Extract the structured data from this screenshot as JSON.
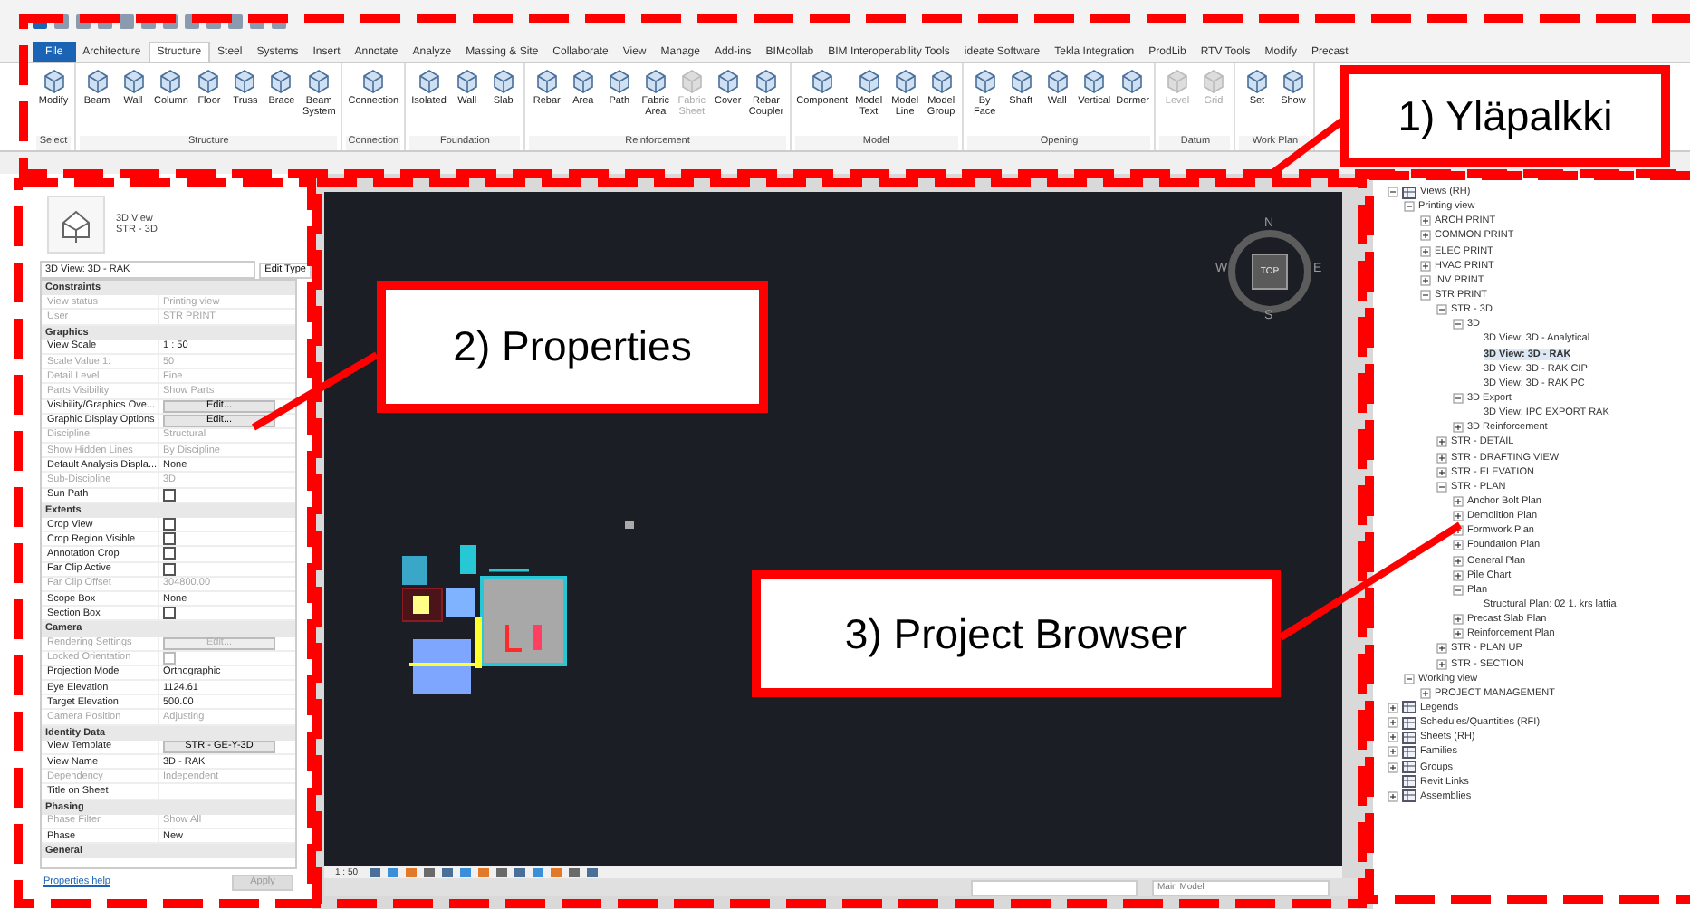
{
  "ribbon_tabs": [
    {
      "label": "File",
      "selected": false,
      "kind": "file"
    },
    {
      "label": "Architecture",
      "selected": false
    },
    {
      "label": "Structure",
      "selected": true
    },
    {
      "label": "Steel",
      "selected": false
    },
    {
      "label": "Systems",
      "selected": false
    },
    {
      "label": "Insert",
      "selected": false
    },
    {
      "label": "Annotate",
      "selected": false
    },
    {
      "label": "Analyze",
      "selected": false
    },
    {
      "label": "Massing & Site",
      "selected": false
    },
    {
      "label": "Collaborate",
      "selected": false
    },
    {
      "label": "View",
      "selected": false
    },
    {
      "label": "Manage",
      "selected": false
    },
    {
      "label": "Add-ins",
      "selected": false
    },
    {
      "label": "BIMcollab",
      "selected": false
    },
    {
      "label": "BIM Interoperability Tools",
      "selected": false
    },
    {
      "label": "ideate Software",
      "selected": false
    },
    {
      "label": "Tekla Integration",
      "selected": false
    },
    {
      "label": "ProdLib",
      "selected": false
    },
    {
      "label": "RTV Tools",
      "selected": false
    },
    {
      "label": "Modify",
      "selected": false
    },
    {
      "label": "Precast",
      "selected": false
    }
  ],
  "ribbon_panels": [
    {
      "label": "Select",
      "tools": [
        {
          "label": "Modify",
          "disabled": false
        }
      ]
    },
    {
      "label": "Structure",
      "tools": [
        {
          "label": "Beam",
          "disabled": false
        },
        {
          "label": "Wall",
          "disabled": false
        },
        {
          "label": "Column",
          "disabled": false
        },
        {
          "label": "Floor",
          "disabled": false
        },
        {
          "label": "Truss",
          "disabled": false
        },
        {
          "label": "Brace",
          "disabled": false
        },
        {
          "label": "Beam System",
          "disabled": false
        }
      ]
    },
    {
      "label": "Connection",
      "tools": [
        {
          "label": "Connection",
          "disabled": false
        }
      ]
    },
    {
      "label": "Foundation",
      "tools": [
        {
          "label": "Isolated",
          "disabled": false
        },
        {
          "label": "Wall",
          "disabled": false
        },
        {
          "label": "Slab",
          "disabled": false
        }
      ]
    },
    {
      "label": "Reinforcement",
      "tools": [
        {
          "label": "Rebar",
          "disabled": false
        },
        {
          "label": "Area",
          "disabled": false
        },
        {
          "label": "Path",
          "disabled": false
        },
        {
          "label": "Fabric Area",
          "disabled": false
        },
        {
          "label": "Fabric Sheet",
          "disabled": true
        },
        {
          "label": "Cover",
          "disabled": false
        },
        {
          "label": "Rebar Coupler",
          "disabled": false
        }
      ]
    },
    {
      "label": "Model",
      "tools": [
        {
          "label": "Component",
          "disabled": false
        },
        {
          "label": "Model Text",
          "disabled": false
        },
        {
          "label": "Model Line",
          "disabled": false
        },
        {
          "label": "Model Group",
          "disabled": false
        }
      ]
    },
    {
      "label": "Opening",
      "tools": [
        {
          "label": "By Face",
          "disabled": false
        },
        {
          "label": "Shaft",
          "disabled": false
        },
        {
          "label": "Wall",
          "disabled": false
        },
        {
          "label": "Vertical",
          "disabled": false
        },
        {
          "label": "Dormer",
          "disabled": false
        }
      ]
    },
    {
      "label": "Datum",
      "tools": [
        {
          "label": "Level",
          "disabled": true
        },
        {
          "label": "Grid",
          "disabled": true
        }
      ]
    },
    {
      "label": "Work Plan",
      "tools": [
        {
          "label": "Set",
          "disabled": false
        },
        {
          "label": "Show",
          "disabled": false
        }
      ]
    }
  ],
  "properties": {
    "family": "3D View",
    "type": "STR - 3D",
    "instance": "3D View: 3D - RAK",
    "edit_type": "Edit Type",
    "groups": [
      {
        "name": "Constraints",
        "rows": [
          {
            "label": "View status",
            "kind": "text",
            "value": "Printing view",
            "disabled": true
          },
          {
            "label": "User",
            "kind": "text",
            "value": "STR PRINT",
            "disabled": true
          }
        ]
      },
      {
        "name": "Graphics",
        "rows": [
          {
            "label": "View Scale",
            "kind": "text",
            "value": "1 : 50",
            "disabled": false
          },
          {
            "label": "Scale Value    1:",
            "kind": "text",
            "value": "50",
            "disabled": true
          },
          {
            "label": "Detail Level",
            "kind": "text",
            "value": "Fine",
            "disabled": true
          },
          {
            "label": "Parts Visibility",
            "kind": "text",
            "value": "Show Parts",
            "disabled": true
          },
          {
            "label": "Visibility/Graphics Ove...",
            "kind": "button",
            "value": "Edit...",
            "disabled": false
          },
          {
            "label": "Graphic Display Options",
            "kind": "button",
            "value": "Edit...",
            "disabled": false
          },
          {
            "label": "Discipline",
            "kind": "text",
            "value": "Structural",
            "disabled": true
          },
          {
            "label": "Show Hidden Lines",
            "kind": "text",
            "value": "By Discipline",
            "disabled": true
          },
          {
            "label": "Default Analysis Displa...",
            "kind": "text",
            "value": "None",
            "disabled": false
          },
          {
            "label": "Sub-Discipline",
            "kind": "text",
            "value": "3D",
            "disabled": true
          },
          {
            "label": "Sun Path",
            "kind": "checkbox",
            "checked": false,
            "disabled": false
          }
        ]
      },
      {
        "name": "Extents",
        "rows": [
          {
            "label": "Crop View",
            "kind": "checkbox",
            "checked": false,
            "disabled": false
          },
          {
            "label": "Crop Region Visible",
            "kind": "checkbox",
            "checked": false,
            "disabled": false
          },
          {
            "label": "Annotation Crop",
            "kind": "checkbox",
            "checked": false,
            "disabled": false
          },
          {
            "label": "Far Clip Active",
            "kind": "checkbox",
            "checked": false,
            "disabled": false
          },
          {
            "label": "Far Clip Offset",
            "kind": "text",
            "value": "304800.00",
            "disabled": true
          },
          {
            "label": "Scope Box",
            "kind": "text",
            "value": "None",
            "disabled": false
          },
          {
            "label": "Section Box",
            "kind": "checkbox",
            "checked": false,
            "disabled": false
          }
        ]
      },
      {
        "name": "Camera",
        "rows": [
          {
            "label": "Rendering Settings",
            "kind": "button",
            "value": "Edit...",
            "disabled": true
          },
          {
            "label": "Locked Orientation",
            "kind": "checkbox",
            "checked": false,
            "disabled": true
          },
          {
            "label": "Projection Mode",
            "kind": "text",
            "value": "Orthographic",
            "disabled": false
          },
          {
            "label": "Eye Elevation",
            "kind": "text",
            "value": "1124.61",
            "disabled": false
          },
          {
            "label": "Target Elevation",
            "kind": "text",
            "value": "500.00",
            "disabled": false
          },
          {
            "label": "Camera Position",
            "kind": "text",
            "value": "Adjusting",
            "disabled": true
          }
        ]
      },
      {
        "name": "Identity Data",
        "rows": [
          {
            "label": "View Template",
            "kind": "button",
            "value": "STR - GE-Y-3D",
            "disabled": false
          },
          {
            "label": "View Name",
            "kind": "text",
            "value": "3D - RAK",
            "disabled": false
          },
          {
            "label": "Dependency",
            "kind": "text",
            "value": "Independent",
            "disabled": true
          },
          {
            "label": "Title on Sheet",
            "kind": "text",
            "disabled": false
          }
        ]
      },
      {
        "name": "Phasing",
        "rows": [
          {
            "label": "Phase Filter",
            "kind": "text",
            "value": "Show All",
            "disabled": true
          },
          {
            "label": "Phase",
            "kind": "text",
            "value": "New",
            "disabled": false
          }
        ]
      },
      {
        "name": "General"
      }
    ],
    "help_link": "Properties help",
    "apply": {
      "label": "Apply",
      "disabled": true
    }
  },
  "viewport": {
    "compass": {
      "north": "N",
      "east": "E",
      "south": "S",
      "west": "W",
      "face": "TOP"
    },
    "scale": "1 : 50",
    "model": "Main Model"
  },
  "project_browser": {
    "tree": [
      {
        "label": "Views (RH)",
        "expanded": true,
        "selected": false,
        "children": [
          {
            "label": "Printing view",
            "expanded": true,
            "selected": false,
            "children": [
              {
                "label": "ARCH PRINT",
                "expanded": false,
                "selected": false
              },
              {
                "label": "COMMON PRINT",
                "expanded": false,
                "selected": false
              },
              {
                "label": "ELEC PRINT",
                "expanded": false,
                "selected": false
              },
              {
                "label": "HVAC PRINT",
                "expanded": false,
                "selected": false
              },
              {
                "label": "INV PRINT",
                "expanded": false,
                "selected": false
              },
              {
                "label": "STR PRINT",
                "expanded": true,
                "selected": false,
                "children": [
                  {
                    "label": "STR - 3D",
                    "expanded": true,
                    "selected": false,
                    "children": [
                      {
                        "label": "3D",
                        "expanded": true,
                        "selected": false,
                        "children": [
                          {
                            "label": "3D View: 3D - Analytical",
                            "selected": false
                          },
                          {
                            "label": "3D View: 3D - RAK",
                            "selected": true
                          },
                          {
                            "label": "3D View: 3D - RAK CIP",
                            "selected": false
                          },
                          {
                            "label": "3D View: 3D - RAK PC",
                            "selected": false
                          }
                        ]
                      },
                      {
                        "label": "3D Export",
                        "expanded": true,
                        "selected": false,
                        "children": [
                          {
                            "label": "3D View: IPC EXPORT RAK",
                            "selected": false
                          }
                        ]
                      },
                      {
                        "label": "3D Reinforcement",
                        "expanded": false,
                        "selected": false
                      }
                    ]
                  },
                  {
                    "label": "STR - DETAIL",
                    "expanded": false,
                    "selected": false
                  },
                  {
                    "label": "STR - DRAFTING VIEW",
                    "expanded": false,
                    "selected": false
                  },
                  {
                    "label": "STR - ELEVATION",
                    "expanded": false,
                    "selected": false
                  },
                  {
                    "label": "STR - PLAN",
                    "expanded": true,
                    "selected": false,
                    "children": [
                      {
                        "label": "Anchor Bolt Plan",
                        "expanded": false,
                        "selected": false
                      },
                      {
                        "label": "Demolition Plan",
                        "expanded": false,
                        "selected": false
                      },
                      {
                        "label": "Formwork Plan",
                        "expanded": false,
                        "selected": false
                      },
                      {
                        "label": "Foundation Plan",
                        "expanded": false,
                        "selected": false
                      },
                      {
                        "label": "General Plan",
                        "expanded": false,
                        "selected": false
                      },
                      {
                        "label": "Pile Chart",
                        "expanded": false,
                        "selected": false
                      },
                      {
                        "label": "Plan",
                        "expanded": true,
                        "selected": false,
                        "children": [
                          {
                            "label": "Structural Plan: 02 1. krs lattia",
                            "selected": false
                          }
                        ]
                      },
                      {
                        "label": "Precast Slab Plan",
                        "expanded": false,
                        "selected": false
                      },
                      {
                        "label": "Reinforcement Plan",
                        "expanded": false,
                        "selected": false
                      }
                    ]
                  },
                  {
                    "label": "STR - PLAN UP",
                    "expanded": false,
                    "selected": false
                  },
                  {
                    "label": "STR - SECTION",
                    "expanded": false,
                    "selected": false
                  }
                ]
              }
            ]
          },
          {
            "label": "Working view",
            "expanded": true,
            "selected": false,
            "children": [
              {
                "label": "PROJECT MANAGEMENT",
                "expanded": false,
                "selected": false
              }
            ]
          }
        ]
      },
      {
        "label": "Legends",
        "expanded": false,
        "selected": false
      },
      {
        "label": "Schedules/Quantities (RFI)",
        "expanded": false,
        "selected": false
      },
      {
        "label": "Sheets (RH)",
        "expanded": false,
        "selected": false
      },
      {
        "label": "Families",
        "expanded": false,
        "selected": false
      },
      {
        "label": "Groups",
        "expanded": false,
        "selected": false
      },
      {
        "label": "Revit Links",
        "selected": false
      },
      {
        "label": "Assemblies",
        "expanded": false,
        "selected": false
      }
    ]
  },
  "annotations": [
    {
      "text": "1) Yläpalkki"
    },
    {
      "text": "2) Properties"
    },
    {
      "text": "3) Project Browser"
    }
  ]
}
